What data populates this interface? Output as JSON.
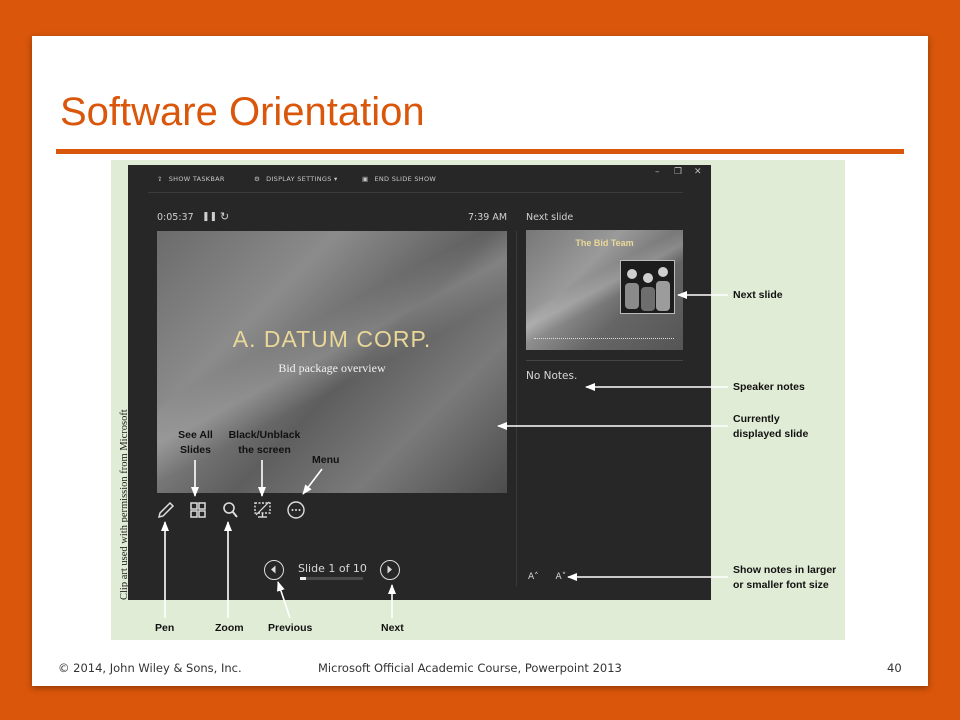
{
  "slide": {
    "title": "Software Orientation",
    "credit": "Clip art used with permission from Microsoft"
  },
  "presenter": {
    "toolbar": {
      "show_taskbar": "SHOW TASKBAR",
      "display_settings": "DISPLAY SETTINGS ▾",
      "end_slide_show": "END SLIDE SHOW"
    },
    "window_buttons": [
      "–",
      "❐",
      "✕"
    ],
    "timer": "0:05:37",
    "clock": "7:39 AM",
    "next_slide_label": "Next slide",
    "current_slide": {
      "title": "A. DATUM CORP.",
      "subtitle": "Bid package overview"
    },
    "next_slide": {
      "title": "The Bid Team"
    },
    "notes": "No Notes.",
    "font_buttons": [
      "A˄",
      "A˅"
    ],
    "slide_counter": "Slide 1 of 10",
    "progress": 0.1,
    "tools": [
      "pen-icon",
      "see-all-slides-icon",
      "zoom-icon",
      "black-screen-icon",
      "menu-icon"
    ]
  },
  "callouts": {
    "see_all_slides": "See All\nSlides",
    "black_unblack": "Black/Unblack\nthe screen",
    "menu": "Menu",
    "next_slide": "Next slide",
    "speaker_notes": "Speaker notes",
    "currently_displayed": "Currently\ndisplayed slide",
    "font_size": "Show notes in larger\nor smaller font size",
    "pen": "Pen",
    "zoom": "Zoom",
    "previous": "Previous",
    "next": "Next"
  },
  "footer": {
    "copyright": "© 2014, John Wiley & Sons, Inc.",
    "course": "Microsoft Official Academic Course, Powerpoint 2013",
    "page": "40"
  },
  "colors": {
    "accent": "#d9560a",
    "figure_bg": "#e1ecd6",
    "presenter_bg": "#272727",
    "slide_title": "#e9d898"
  }
}
